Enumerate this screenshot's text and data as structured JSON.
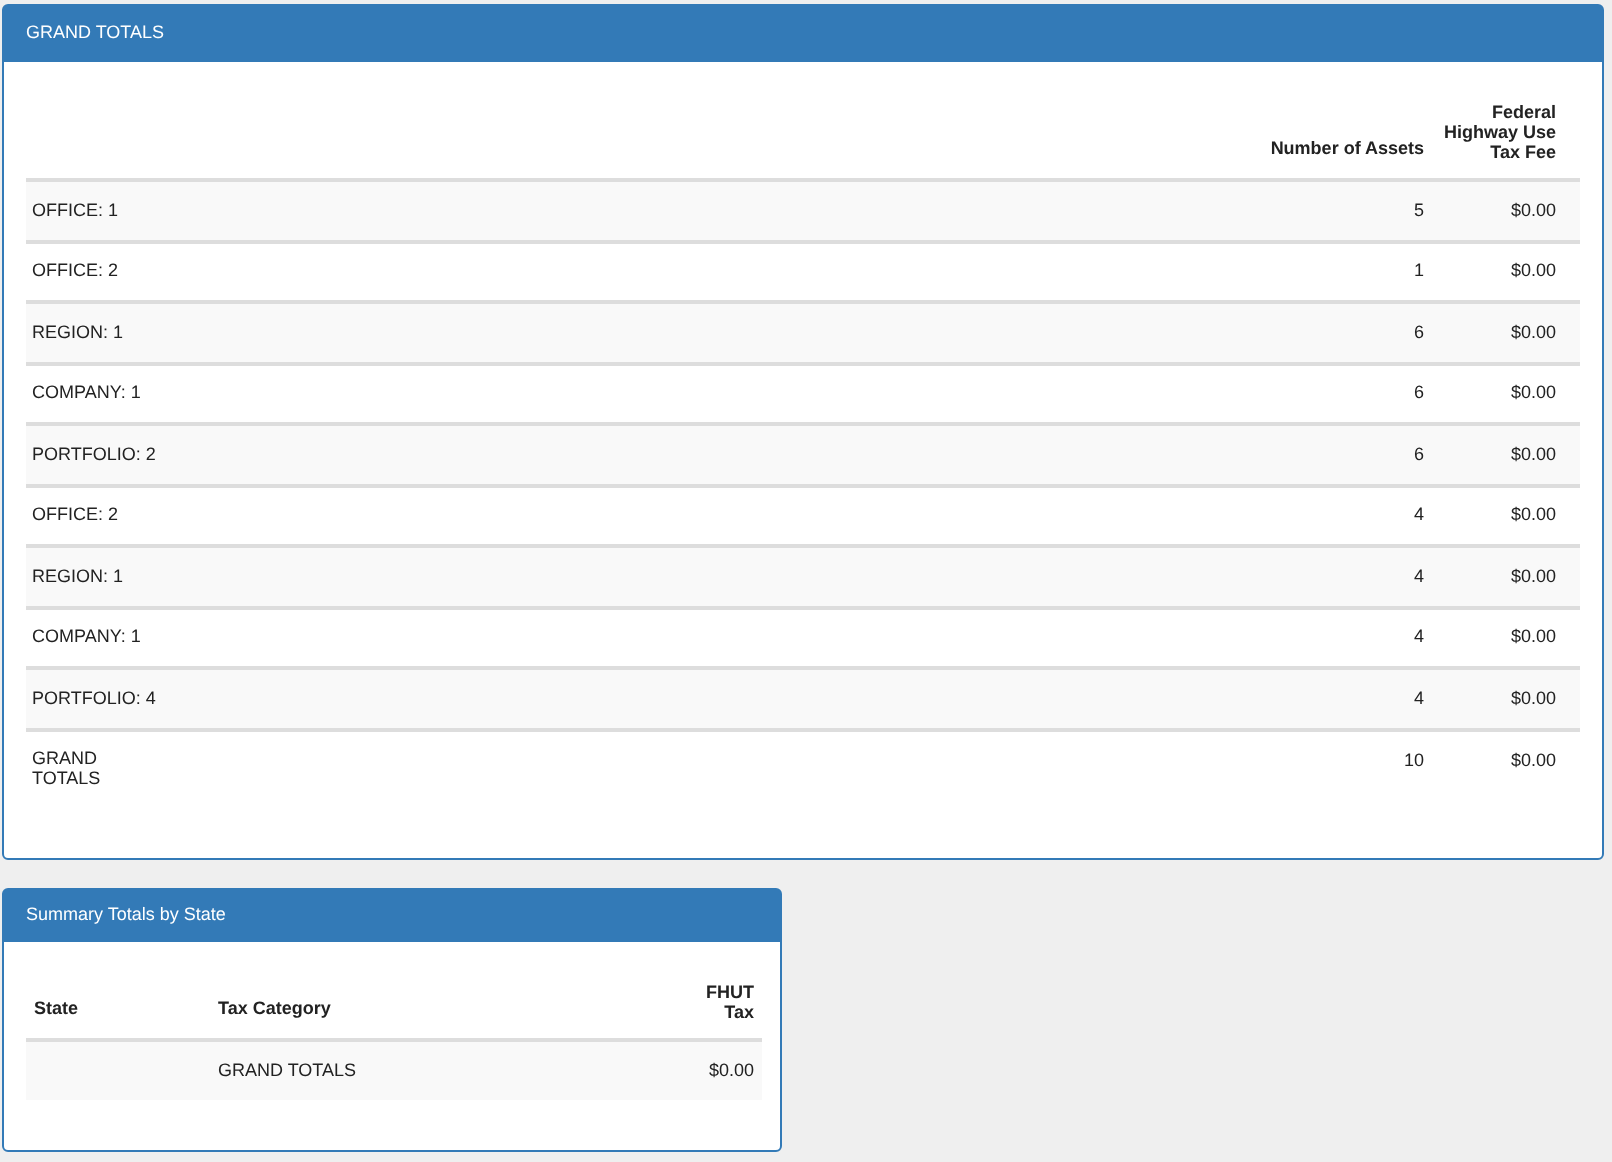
{
  "grand_totals": {
    "title": "GRAND TOTALS",
    "columns": [
      "Number of Assets",
      "Federal Highway Use Tax Fee"
    ],
    "rows": [
      {
        "label": "OFFICE: 1",
        "assets": "5",
        "fee": "$0.00"
      },
      {
        "label": "OFFICE: 2",
        "assets": "1",
        "fee": "$0.00"
      },
      {
        "label": "REGION: 1",
        "assets": "6",
        "fee": "$0.00"
      },
      {
        "label": "COMPANY: 1",
        "assets": "6",
        "fee": "$0.00"
      },
      {
        "label": "PORTFOLIO: 2",
        "assets": "6",
        "fee": "$0.00"
      },
      {
        "label": "OFFICE: 2",
        "assets": "4",
        "fee": "$0.00"
      },
      {
        "label": "REGION: 1",
        "assets": "4",
        "fee": "$0.00"
      },
      {
        "label": "COMPANY: 1",
        "assets": "4",
        "fee": "$0.00"
      },
      {
        "label": "PORTFOLIO: 4",
        "assets": "4",
        "fee": "$0.00"
      },
      {
        "label": "GRAND TOTALS",
        "assets": "10",
        "fee": "$0.00"
      }
    ]
  },
  "summary_by_state": {
    "title": "Summary Totals by State",
    "columns": [
      "State",
      "Tax Category",
      "FHUT Tax"
    ],
    "rows": [
      {
        "state": "",
        "category": "GRAND TOTALS",
        "tax": "$0.00"
      }
    ]
  }
}
